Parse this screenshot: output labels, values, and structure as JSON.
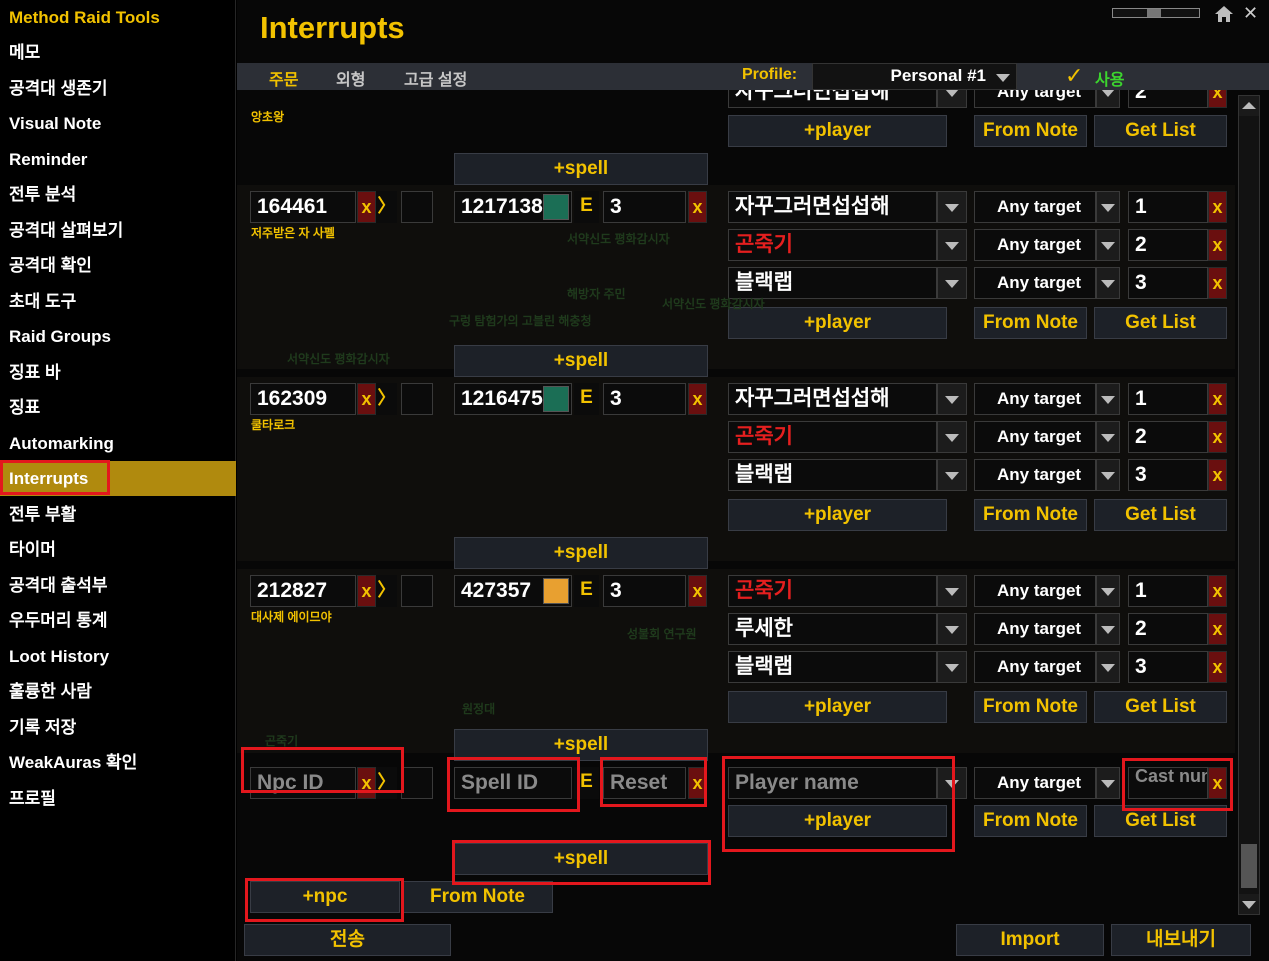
{
  "app": {
    "title": "Method Raid Tools"
  },
  "sidebar": {
    "items": [
      {
        "label": "메모"
      },
      {
        "label": "공격대 생존기"
      },
      {
        "label": "Visual Note"
      },
      {
        "label": "Reminder"
      },
      {
        "label": "전투 분석"
      },
      {
        "label": "공격대 살펴보기"
      },
      {
        "label": "공격대 확인"
      },
      {
        "label": "초대 도구"
      },
      {
        "label": "Raid Groups"
      },
      {
        "label": "징표 바"
      },
      {
        "label": "징표"
      },
      {
        "label": "Automarking"
      },
      {
        "label": "Interrupts",
        "active": true
      },
      {
        "label": "전투 부활"
      },
      {
        "label": "타이머"
      },
      {
        "label": "공격대 출석부"
      },
      {
        "label": "우두머리 통계"
      },
      {
        "label": "Loot History"
      },
      {
        "label": "훌륭한 사람"
      },
      {
        "label": "기록 저장"
      },
      {
        "label": "WeakAuras 확인"
      },
      {
        "label": "프로필"
      }
    ]
  },
  "header": {
    "title": "Interrupts",
    "tabs": [
      {
        "label": "주문",
        "active": true
      },
      {
        "label": "외형"
      },
      {
        "label": "고급 설정"
      }
    ],
    "profile_label": "Profile:",
    "profile_value": "Personal #1",
    "use_label": "사용",
    "checkmark": "✓",
    "close": "✕"
  },
  "labels": {
    "x": "x",
    "arrow": "〉",
    "e": "E",
    "add_player": "+player",
    "from_note": "From Note",
    "get_list": "Get List",
    "add_spell": "+spell",
    "add_npc": "+npc",
    "any_target": "Any target"
  },
  "partial_group": {
    "npc_name": "앙초왕",
    "player": "자꾸그러면섭섭해",
    "target": "Any target",
    "num": "2"
  },
  "groups": [
    {
      "npc_id": "164461",
      "npc_name": "저주받은 자 사펠",
      "spell_id": "1217138",
      "spell_icon_color": "#1b6e55",
      "reset": "3",
      "players": [
        {
          "name": "자꾸그러면섭섭해",
          "color": "#ffffff",
          "target": "Any target",
          "num": "1"
        },
        {
          "name": "곤죽기",
          "color": "#e51f1f",
          "target": "Any target",
          "num": "2"
        },
        {
          "name": "블랙랩",
          "color": "#ffffff",
          "target": "Any target",
          "num": "3"
        }
      ]
    },
    {
      "npc_id": "162309",
      "npc_name": "쿨타로크",
      "spell_id": "1216475",
      "spell_icon_color": "#1b6e55",
      "reset": "3",
      "players": [
        {
          "name": "자꾸그러면섭섭해",
          "color": "#ffffff",
          "target": "Any target",
          "num": "1"
        },
        {
          "name": "곤죽기",
          "color": "#e51f1f",
          "target": "Any target",
          "num": "2"
        },
        {
          "name": "블랙랩",
          "color": "#ffffff",
          "target": "Any target",
          "num": "3"
        }
      ]
    },
    {
      "npc_id": "212827",
      "npc_name": "대사제 에이므야",
      "spell_id": "427357",
      "spell_icon_color": "#e8a030",
      "reset": "3",
      "players": [
        {
          "name": "곤죽기",
          "color": "#e51f1f",
          "target": "Any target",
          "num": "1"
        },
        {
          "name": "루세한",
          "color": "#ffffff",
          "target": "Any target",
          "num": "2"
        },
        {
          "name": "블랙랩",
          "color": "#ffffff",
          "target": "Any target",
          "num": "3"
        }
      ]
    }
  ],
  "new_entry": {
    "npc_placeholder": "Npc ID",
    "spell_placeholder": "Spell ID",
    "reset_placeholder": "Reset",
    "player_placeholder": "Player name",
    "target": "Any target",
    "cast_placeholder": "Cast num"
  },
  "footer": {
    "send": "전송",
    "import": "Import",
    "export": "내보내기"
  },
  "background_labels": [
    "서약신도 평화감시자",
    "해방자 주민",
    "구렁 탐험가의 고블린 해충청",
    "서약신도 평화감시자",
    "서약신도 평화감시자",
    "성불회 연구원",
    "곤죽기",
    "원정대"
  ],
  "colors": {
    "accent": "#f2c200",
    "highlight": "#e3171d",
    "active_bg": "#b08a0e",
    "remove_button": "#6a0f0f",
    "red_player": "#e51f1f"
  }
}
